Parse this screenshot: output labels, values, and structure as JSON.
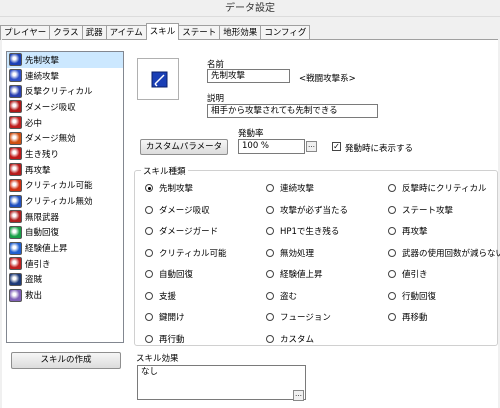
{
  "window": {
    "title": "データ設定"
  },
  "tabs": [
    "プレイヤー",
    "クラス",
    "武器",
    "アイテム",
    "スキル",
    "ステート",
    "地形効果",
    "コンフィグ"
  ],
  "active_tab": "スキル",
  "skill_list": [
    {
      "name": "先制攻撃",
      "icon": "sword-icon",
      "color": "#1a3fb5",
      "selected": true
    },
    {
      "name": "連続攻撃",
      "icon": "swords-icon",
      "color": "#3050c8"
    },
    {
      "name": "反撃クリティカル",
      "icon": "sword-icon",
      "color": "#2a40b0"
    },
    {
      "name": "ダメージ吸収",
      "icon": "drain-icon",
      "color": "#b01818"
    },
    {
      "name": "必中",
      "icon": "target-icon",
      "color": "#c02020"
    },
    {
      "name": "ダメージ無効",
      "icon": "shield-icon",
      "color": "#d05010"
    },
    {
      "name": "生き残り",
      "icon": "heart-icon",
      "color": "#c01818"
    },
    {
      "name": "再攻撃",
      "icon": "arrow-icon",
      "color": "#b81a1a"
    },
    {
      "name": "クリティカル可能",
      "icon": "star-icon",
      "color": "#d03010"
    },
    {
      "name": "クリティカル無効",
      "icon": "star-icon",
      "color": "#2050c0"
    },
    {
      "name": "無限武器",
      "icon": "infinity-icon",
      "color": "#b02020"
    },
    {
      "name": "自動回復",
      "icon": "cross-icon",
      "color": "#18a048"
    },
    {
      "name": "経験値上昇",
      "icon": "arrow-up-icon",
      "color": "#2060d0"
    },
    {
      "name": "値引き",
      "icon": "coin-icon",
      "color": "#c02020"
    },
    {
      "name": "盗賊",
      "icon": "bag-icon",
      "color": "#1d3a78"
    },
    {
      "name": "救出",
      "icon": "rescue-icon",
      "color": "#8060b8"
    }
  ],
  "create_skill_button": "スキルの作成",
  "labels": {
    "name": "名前",
    "description": "説明",
    "activation": "発動率",
    "skill_type": "スキル種類",
    "skill_effect": "スキル効果",
    "show_on_activate": "発動時に表示する"
  },
  "fields": {
    "name_value": "先制攻撃",
    "name_tag": "<戦闘攻撃系>",
    "description_value": "相手から攻撃されても先制できる",
    "activation_value": "100 %",
    "effect_value": "なし",
    "dots": "…"
  },
  "custom_param_button": "カスタムパラメータ",
  "show_on_activate_checked": true,
  "checkmark": "✓",
  "skill_types": [
    [
      "先制攻撃",
      "連続攻撃",
      "反撃時にクリティカル"
    ],
    [
      "ダメージ吸収",
      "攻撃が必ず当たる",
      "ステート攻撃"
    ],
    [
      "ダメージガード",
      "HP1で生き残る",
      "再攻撃"
    ],
    [
      "クリティカル可能",
      "無効処理",
      "武器の使用回数が減らない"
    ],
    [
      "自動回復",
      "経験値上昇",
      "値引き"
    ],
    [
      "支援",
      "盗む",
      "行動回復"
    ],
    [
      "鍵開け",
      "フュージョン",
      "再移動"
    ],
    [
      "再行動",
      "カスタム",
      ""
    ]
  ],
  "selected_skill_type": "先制攻撃",
  "colors": {
    "selection": "#cce8ff",
    "icon_blue": "#1a3fb5"
  }
}
